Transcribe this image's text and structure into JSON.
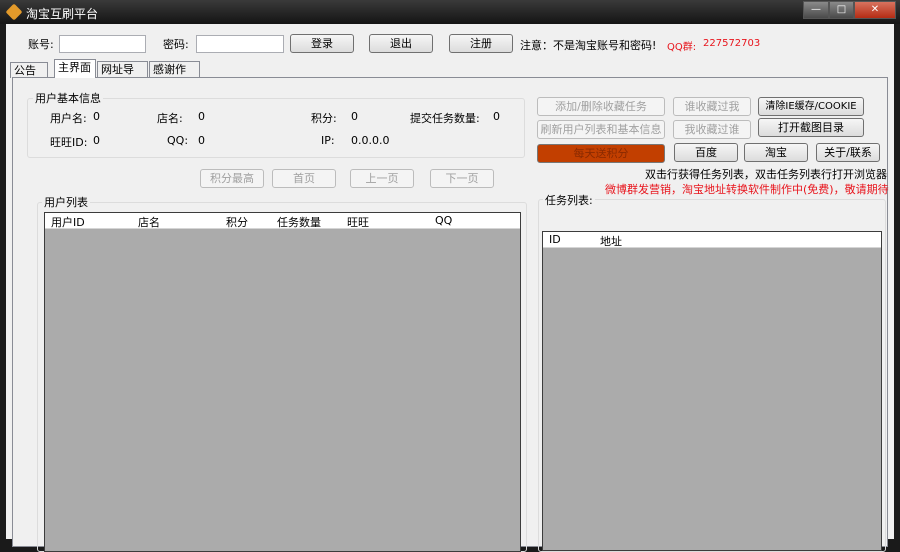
{
  "window": {
    "title": "淘宝互刷平台",
    "minimize": "—",
    "maximize": "□",
    "close": "✕"
  },
  "login": {
    "account_label": "账号:",
    "account_value": "",
    "password_label": "密码:",
    "password_value": "",
    "login_btn": "登录",
    "logout_btn": "退出",
    "register_btn": "注册",
    "notice": "注意：不是淘宝账号和密码!",
    "qq_group_label": "QQ群:",
    "qq_group_value": "227572703"
  },
  "tabs": [
    "公告",
    "主界面",
    "网址导航",
    "感谢作者"
  ],
  "user_info": {
    "title": "用户基本信息",
    "username_label": "用户名:",
    "username": "0",
    "shop_label": "店名:",
    "shop": "0",
    "points_label": "积分:",
    "points": "0",
    "tasks_label": "提交任务数量:",
    "tasks": "0",
    "wangwang_label": "旺旺ID:",
    "wangwang": "0",
    "qq_label": "QQ:",
    "qq": "0",
    "ip_label": "IP:",
    "ip": "0.0.0.0"
  },
  "actions": {
    "add_task": "添加/删除收藏任务",
    "who_fav_me": "谁收藏过我",
    "clear_cache": "清除IE缓存/COOKIE",
    "refresh": "刷新用户列表和基本信息",
    "i_fav_who": "我收藏过谁",
    "open_screenshot": "打开截图目录",
    "daily_points": "每天送积分",
    "baidu": "百度",
    "taobao": "淘宝",
    "about": "关于/联系",
    "hint": "双击行获得任务列表，双击任务列表行打开浏览器",
    "promo": "微博群发营销，淘宝地址转换软件制作中(免费)，敬请期待"
  },
  "pager": {
    "top_points": "积分最高",
    "first": "首页",
    "prev": "上一页",
    "next": "下一页"
  },
  "user_list": {
    "title": "用户列表",
    "columns": [
      "用户ID",
      "店名",
      "积分",
      "任务数量",
      "旺旺",
      "QQ"
    ]
  },
  "task_list": {
    "title": "任务列表:",
    "columns": [
      "ID",
      "地址"
    ]
  }
}
